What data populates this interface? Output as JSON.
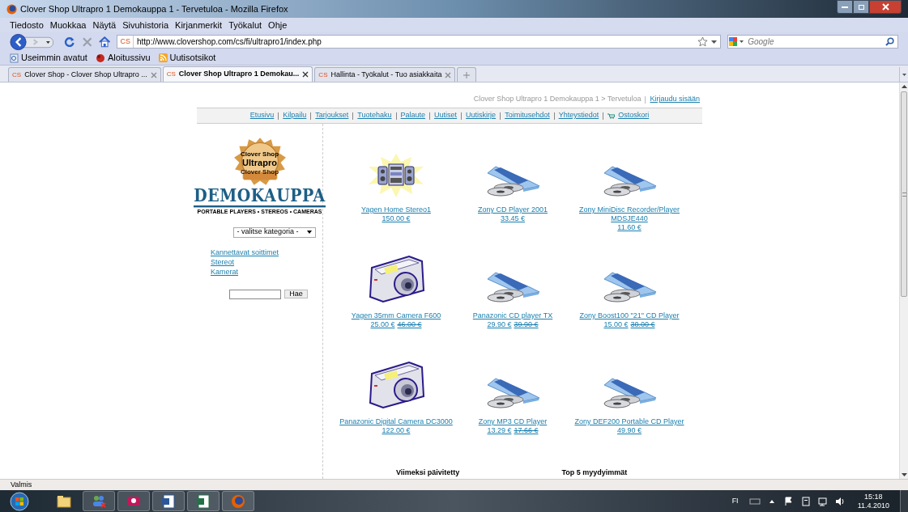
{
  "window": {
    "title": "Clover Shop Ultrapro 1 Demokauppa 1 - Tervetuloa - Mozilla Firefox"
  },
  "menu": [
    "Tiedosto",
    "Muokkaa",
    "Näytä",
    "Sivuhistoria",
    "Kirjanmerkit",
    "Työkalut",
    "Ohje"
  ],
  "address_bar": {
    "favicon": "CS",
    "url": "http://www.clovershop.com/cs/fi/ultrapro1/index.php"
  },
  "search": {
    "placeholder": "Google"
  },
  "bookmarks": [
    "Useimmin avatut",
    "Aloitussivu",
    "Uutisotsikot"
  ],
  "tabs": [
    {
      "favicon": "CS",
      "label": "Clover Shop - Clover Shop Ultrapro ...",
      "selected": false
    },
    {
      "favicon": "CS",
      "label": "Clover Shop Ultrapro 1 Demokau...",
      "selected": true
    },
    {
      "favicon": "CS",
      "label": "Hallinta - Työkalut - Tuo asiakkaita",
      "selected": false
    }
  ],
  "page": {
    "breadcrumb": "Clover Shop Ultrapro 1 Demokauppa 1 > Tervetuloa",
    "login_link": "Kirjaudu sisään",
    "nav": [
      "Etusivu",
      "Kilpailu",
      "Tarjoukset",
      "Tuotehaku",
      "Palaute",
      "Uutiset",
      "Uutiskirje",
      "Toimitusehdot",
      "Yhteystiedot",
      "Ostoskori"
    ],
    "logo": {
      "badge_top": "Clover Shop",
      "badge_main": "Ultrapro",
      "badge_ribbon": "Clover Shop",
      "name": "DEMOKAUPPA",
      "tagline": "PORTABLE PLAYERS • STEREOS • CAMERAS"
    },
    "category_select": "- valitse kategoria -",
    "categories": [
      "Kannettavat soittimet",
      "Stereot",
      "Kamerat"
    ],
    "search_button": "Hae",
    "products": [
      {
        "kind": "stereo",
        "name": "Yagen Home Stereo1",
        "price": "150.00 €"
      },
      {
        "kind": "cd",
        "name": "Zony CD Player 2001",
        "price": "33.45 €"
      },
      {
        "kind": "cd",
        "name": "Zony MiniDisc Recorder/Player MDSJE440",
        "price": "11.60 €"
      },
      {
        "kind": "camera",
        "name": "Yagen 35mm Camera F600",
        "price": "25.00 €",
        "old_price": "46.00 €"
      },
      {
        "kind": "cd",
        "name": "Panazonic CD player TX",
        "price": "29.90 €",
        "old_price": "39.90 €"
      },
      {
        "kind": "cd",
        "name": "Zony Boost100 \"21\" CD Player",
        "price": "15.00 €",
        "old_price": "30.00 €"
      },
      {
        "kind": "camera",
        "name": "Panazonic Digital Camera DC3000",
        "price": "122.00 €"
      },
      {
        "kind": "cd",
        "name": "Zony MP3 CD Player",
        "price": "13.29 €",
        "old_price": "17.66 €"
      },
      {
        "kind": "cd",
        "name": "Zony DEF200 Portable CD Player",
        "price": "49.90 €"
      }
    ],
    "section_headings": [
      "Viimeksi päivitetty",
      "Top 5 myydyimmät"
    ]
  },
  "status_bar": "Valmis",
  "taskbar": {
    "language": "FI",
    "time": "15:18",
    "date": "11.4.2010"
  }
}
